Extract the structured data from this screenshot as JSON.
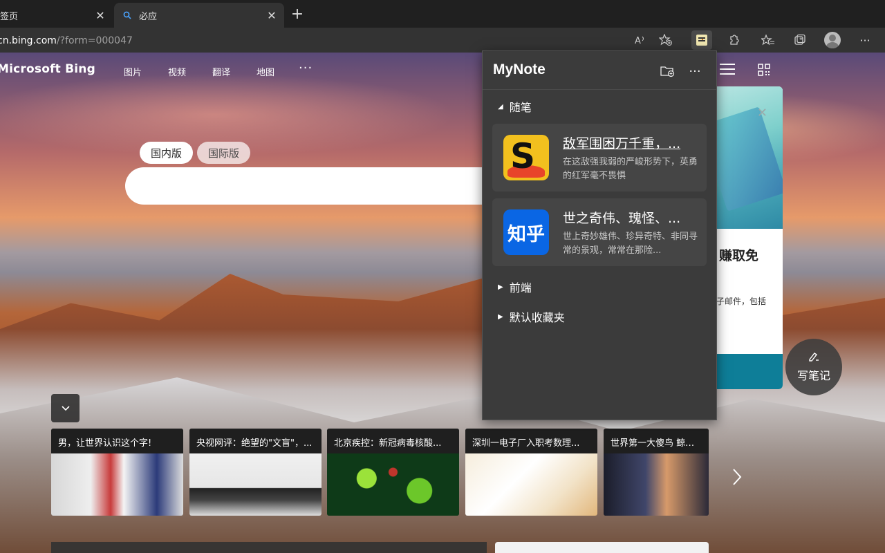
{
  "browser": {
    "tabs": [
      {
        "label": "签页",
        "active": false
      },
      {
        "label": "必应",
        "active": true
      }
    ],
    "address": {
      "host": "cn.bing.com",
      "path": "/?form=000047"
    }
  },
  "bing": {
    "logo": "Microsoft Bing",
    "nav": [
      "图片",
      "视频",
      "翻译",
      "地图"
    ],
    "more": "···",
    "scopes": [
      "国内版",
      "国际版"
    ]
  },
  "promo": {
    "title": "赚取免",
    "subtitle": "子邮件，包括"
  },
  "write_note": {
    "label": "写笔记"
  },
  "news": [
    {
      "caption": "男，让世界认识这个字!"
    },
    {
      "caption": "央视网评：绝望的\"文盲\"，..."
    },
    {
      "caption": "北京疾控：新冠病毒核酸..."
    },
    {
      "caption": "深圳一电子厂入职考数理..."
    },
    {
      "caption": "世界第一大傻鸟 鲸头鹳"
    }
  ],
  "mynote": {
    "title": "MyNote",
    "folders": [
      {
        "name": "随笔",
        "expanded": true
      },
      {
        "name": "前端",
        "expanded": false
      },
      {
        "name": "默认收藏夹",
        "expanded": false
      }
    ],
    "notes": [
      {
        "title": "敌军围困万千重，...",
        "desc": "在这敌强我弱的严峻形势下，英勇的红军毫不畏惧",
        "source": "sogou"
      },
      {
        "title": "世之奇伟、瑰怪、...",
        "desc": "世上奇妙雄伟、珍异奇特、非同寻常的景观，常常在那险...",
        "source": "zhihu",
        "icon_text": "知乎"
      }
    ]
  },
  "colors": {
    "tabstrip": "#202020",
    "toolbar": "#333333",
    "panel": "#3b3b3b",
    "note_card": "#454545",
    "promo_bar": "#0e7e98"
  }
}
